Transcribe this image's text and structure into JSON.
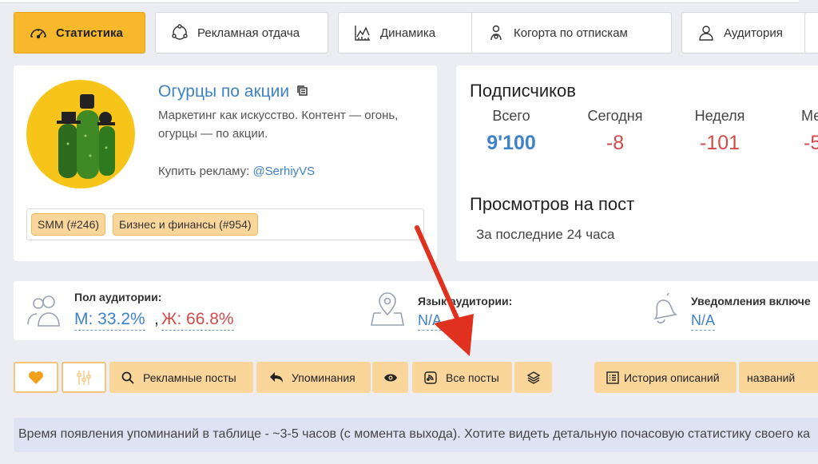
{
  "tabs": [
    {
      "label": "Статистика",
      "icon": "speedometer-icon"
    },
    {
      "label": "Рекламная отдача",
      "icon": "network-icon"
    },
    {
      "label": "Динамика",
      "icon": "line-chart-icon"
    },
    {
      "label": "Когорта по отпискам",
      "icon": "user-cog-icon"
    },
    {
      "label": "Аудитория",
      "icon": "user-icon"
    }
  ],
  "channel": {
    "title": "Огурцы по акции",
    "description": "Маркетинг как искусство. Контент — огонь, огурцы — по акции.",
    "buy_label": "Купить рекламу:",
    "buy_handle": "@SerhiyVS",
    "categories": [
      "SMM (#246)",
      "Бизнес и финансы (#954)"
    ]
  },
  "subscribers": {
    "title": "Подписчиков",
    "stats": [
      {
        "label": "Всего",
        "value": "9'100"
      },
      {
        "label": "Сегодня",
        "value": "-8"
      },
      {
        "label": "Неделя",
        "value": "-101"
      },
      {
        "label": "Ме",
        "value": "-5"
      }
    ]
  },
  "views": {
    "title": "Просмотров на пост",
    "subtitle": "За последние 24 часа"
  },
  "audience": {
    "gender_label": "Пол аудитории:",
    "male": "М: 33.2%",
    "comma": ",",
    "female": "Ж: 66.8%",
    "language_label": "Язык аудитории:",
    "language_value": "N/A",
    "notifications_label": "Уведомления включе",
    "notifications_value": "N/A"
  },
  "actions": {
    "ad_posts": "Рекламные посты",
    "mentions": "Упоминания",
    "all_posts": "Все посты",
    "desc_history": "История описаний",
    "names": "названий"
  },
  "info": {
    "text": "Время появления упоминаний в таблице - ~3-5 часов (с момента выхода). Хотите видеть детальную почасовую статистику своего ка"
  },
  "colors": {
    "accent": "#f8b82c",
    "link": "#3f82c8",
    "negative": "#d24b4b",
    "female": "#d24b4b",
    "button": "#fbd69b",
    "arrow": "#e0301e"
  }
}
